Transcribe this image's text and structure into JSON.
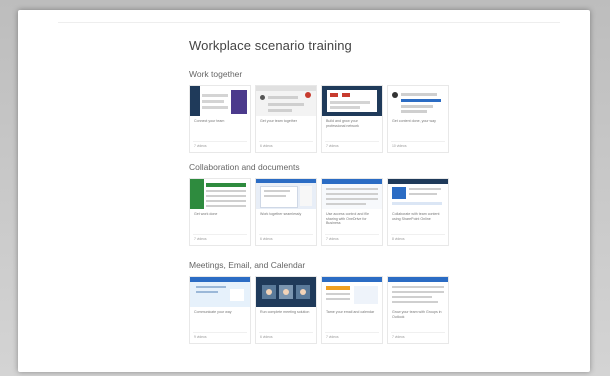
{
  "page": {
    "title": "Workplace scenario training"
  },
  "sections": [
    {
      "title": "Work together",
      "cards": [
        {
          "caption": "Connect your team",
          "foot": "7 videos"
        },
        {
          "caption": "Get your team together",
          "foot": "6 videos"
        },
        {
          "caption": "Build and grow your professional network",
          "foot": "7 videos"
        },
        {
          "caption": "Get content done, your way",
          "foot": "10 videos"
        }
      ]
    },
    {
      "title": "Collaboration and documents",
      "cards": [
        {
          "caption": "Get work done",
          "foot": "7 videos"
        },
        {
          "caption": "Work together seamlessly",
          "foot": "6 videos"
        },
        {
          "caption": "Use access control and file sharing with OneDrive for Business",
          "foot": "7 videos"
        },
        {
          "caption": "Collaborate with team content using SharePoint Online",
          "foot": "8 videos"
        }
      ]
    },
    {
      "title": "Meetings, Email, and Calendar",
      "cards": [
        {
          "caption": "Communicate your way",
          "foot": "9 videos"
        },
        {
          "caption": "Run complete meeting solution",
          "foot": "6 videos"
        },
        {
          "caption": "Tame your email and calendar",
          "foot": "7 videos"
        },
        {
          "caption": "Grow your team with Groups in Outlook",
          "foot": "7 videos"
        }
      ]
    }
  ],
  "colors": {
    "purple": "#4b3a8c",
    "blue": "#2b6cc4",
    "green": "#2e8b3e",
    "red": "#c73b2e",
    "orange": "#f0a020",
    "dark": "#1f3a5a"
  }
}
